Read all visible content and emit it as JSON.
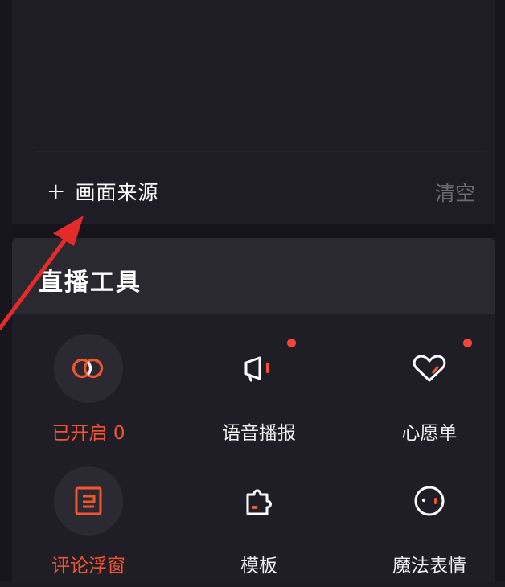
{
  "source": {
    "add_label": "画面来源",
    "clear_label": "清空"
  },
  "tools": {
    "title": "直播工具",
    "items": [
      {
        "label": "已开启 0",
        "icon": "link-rings-icon",
        "active": true,
        "badge": false
      },
      {
        "label": "语音播报",
        "icon": "megaphone-icon",
        "active": false,
        "badge": true
      },
      {
        "label": "心愿单",
        "icon": "heart-icon",
        "active": false,
        "badge": true
      },
      {
        "label": "评论浮窗",
        "icon": "comment-window-icon",
        "active": true,
        "badge": false
      },
      {
        "label": "模板",
        "icon": "puzzle-icon",
        "active": false,
        "badge": false
      },
      {
        "label": "魔法表情",
        "icon": "face-icon",
        "active": false,
        "badge": false
      }
    ]
  },
  "colors": {
    "accent": "#f5542d",
    "badge": "#f8453b",
    "background": "#1c1b22",
    "muted_text": "#6b6a72"
  }
}
